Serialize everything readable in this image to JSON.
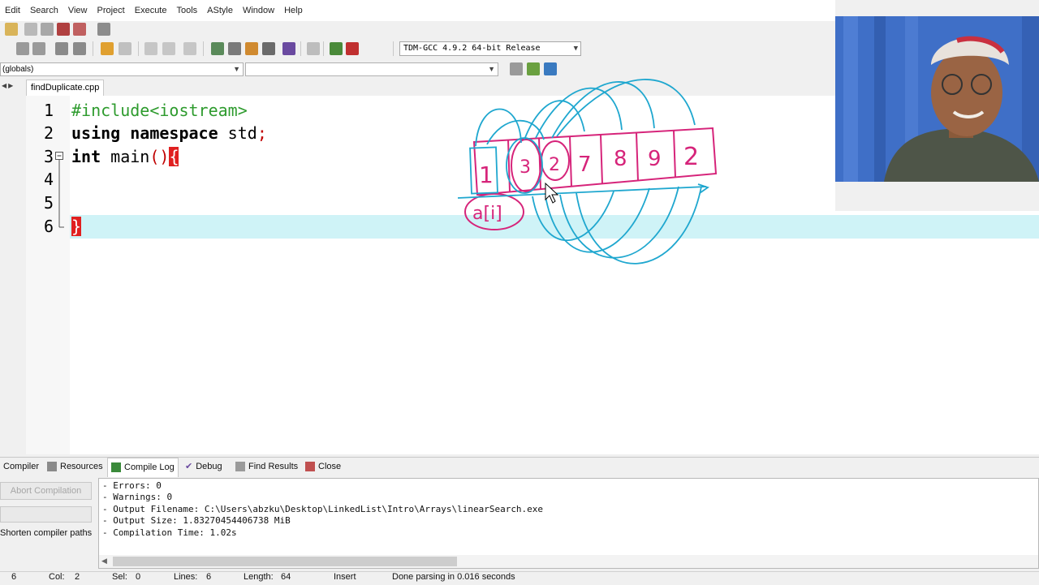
{
  "menu": [
    "Edit",
    "Search",
    "View",
    "Project",
    "Execute",
    "Tools",
    "AStyle",
    "Window",
    "Help"
  ],
  "toolbar": {
    "compiler": "TDM-GCC 4.9.2 64-bit Release",
    "scope": "(globals)"
  },
  "editor": {
    "tab_name": "findDuplicate.cpp",
    "line_numbers": [
      "1",
      "2",
      "3",
      "4",
      "5",
      "6"
    ],
    "code": {
      "include": "#include<iostream>",
      "using": "using",
      "namespace": "namespace",
      "std": " std",
      "semicolon": ";",
      "int": "int",
      "main": " main",
      "parens": "()",
      "open_brace": "{",
      "close_brace": "}"
    }
  },
  "drawing": {
    "array_values": [
      "1",
      "3",
      "2",
      "7",
      "8",
      "9",
      "2"
    ],
    "index_label": "a[i]"
  },
  "bottom_tabs": {
    "compiler": "Compiler",
    "resources": "Resources",
    "compile_log": "Compile Log",
    "debug": "Debug",
    "find_results": "Find Results",
    "close": "Close"
  },
  "panel": {
    "abort": "Abort Compilation",
    "shorten": "Shorten compiler paths",
    "log": [
      "- Errors: 0",
      "- Warnings: 0",
      "- Output Filename: C:\\Users\\abzku\\Desktop\\LinkedList\\Intro\\Arrays\\linearSearch.exe",
      "- Output Size: 1.83270454406738 MiB",
      "- Compilation Time: 1.02s"
    ]
  },
  "status": {
    "line": "6",
    "col_label": "Col:",
    "col": "2",
    "sel_label": "Sel:",
    "sel": "0",
    "lines_label": "Lines:",
    "lines": "6",
    "length_label": "Length:",
    "length": "64",
    "mode": "Insert",
    "message": "Done parsing in 0.016 seconds"
  },
  "colors": {
    "sketch_pink": "#d6247a",
    "sketch_blue": "#1fa7cf",
    "line_highlight": "#cff3f7"
  }
}
